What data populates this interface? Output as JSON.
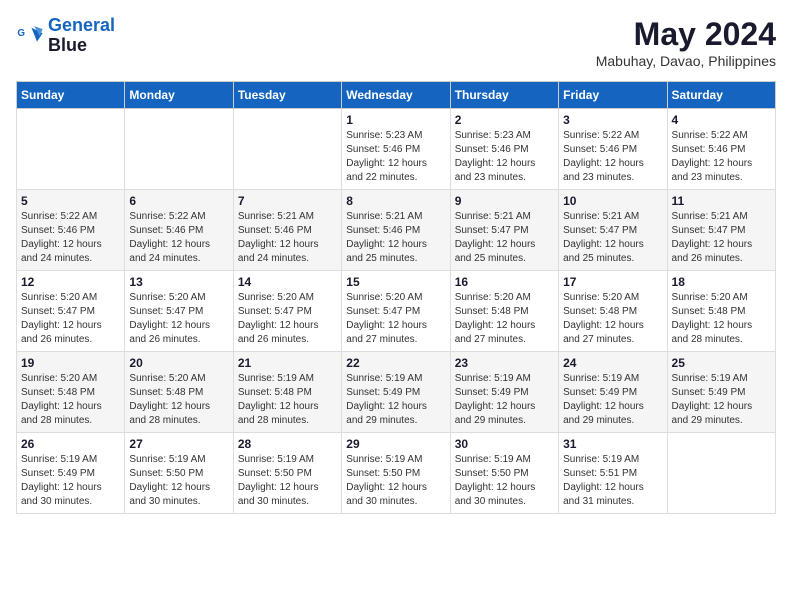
{
  "logo": {
    "line1": "General",
    "line2": "Blue"
  },
  "title": "May 2024",
  "subtitle": "Mabuhay, Davao, Philippines",
  "days_of_week": [
    "Sunday",
    "Monday",
    "Tuesday",
    "Wednesday",
    "Thursday",
    "Friday",
    "Saturday"
  ],
  "weeks": [
    [
      {
        "day": "",
        "info": ""
      },
      {
        "day": "",
        "info": ""
      },
      {
        "day": "",
        "info": ""
      },
      {
        "day": "1",
        "info": "Sunrise: 5:23 AM\nSunset: 5:46 PM\nDaylight: 12 hours\nand 22 minutes."
      },
      {
        "day": "2",
        "info": "Sunrise: 5:23 AM\nSunset: 5:46 PM\nDaylight: 12 hours\nand 23 minutes."
      },
      {
        "day": "3",
        "info": "Sunrise: 5:22 AM\nSunset: 5:46 PM\nDaylight: 12 hours\nand 23 minutes."
      },
      {
        "day": "4",
        "info": "Sunrise: 5:22 AM\nSunset: 5:46 PM\nDaylight: 12 hours\nand 23 minutes."
      }
    ],
    [
      {
        "day": "5",
        "info": "Sunrise: 5:22 AM\nSunset: 5:46 PM\nDaylight: 12 hours\nand 24 minutes."
      },
      {
        "day": "6",
        "info": "Sunrise: 5:22 AM\nSunset: 5:46 PM\nDaylight: 12 hours\nand 24 minutes."
      },
      {
        "day": "7",
        "info": "Sunrise: 5:21 AM\nSunset: 5:46 PM\nDaylight: 12 hours\nand 24 minutes."
      },
      {
        "day": "8",
        "info": "Sunrise: 5:21 AM\nSunset: 5:46 PM\nDaylight: 12 hours\nand 25 minutes."
      },
      {
        "day": "9",
        "info": "Sunrise: 5:21 AM\nSunset: 5:47 PM\nDaylight: 12 hours\nand 25 minutes."
      },
      {
        "day": "10",
        "info": "Sunrise: 5:21 AM\nSunset: 5:47 PM\nDaylight: 12 hours\nand 25 minutes."
      },
      {
        "day": "11",
        "info": "Sunrise: 5:21 AM\nSunset: 5:47 PM\nDaylight: 12 hours\nand 26 minutes."
      }
    ],
    [
      {
        "day": "12",
        "info": "Sunrise: 5:20 AM\nSunset: 5:47 PM\nDaylight: 12 hours\nand 26 minutes."
      },
      {
        "day": "13",
        "info": "Sunrise: 5:20 AM\nSunset: 5:47 PM\nDaylight: 12 hours\nand 26 minutes."
      },
      {
        "day": "14",
        "info": "Sunrise: 5:20 AM\nSunset: 5:47 PM\nDaylight: 12 hours\nand 26 minutes."
      },
      {
        "day": "15",
        "info": "Sunrise: 5:20 AM\nSunset: 5:47 PM\nDaylight: 12 hours\nand 27 minutes."
      },
      {
        "day": "16",
        "info": "Sunrise: 5:20 AM\nSunset: 5:48 PM\nDaylight: 12 hours\nand 27 minutes."
      },
      {
        "day": "17",
        "info": "Sunrise: 5:20 AM\nSunset: 5:48 PM\nDaylight: 12 hours\nand 27 minutes."
      },
      {
        "day": "18",
        "info": "Sunrise: 5:20 AM\nSunset: 5:48 PM\nDaylight: 12 hours\nand 28 minutes."
      }
    ],
    [
      {
        "day": "19",
        "info": "Sunrise: 5:20 AM\nSunset: 5:48 PM\nDaylight: 12 hours\nand 28 minutes."
      },
      {
        "day": "20",
        "info": "Sunrise: 5:20 AM\nSunset: 5:48 PM\nDaylight: 12 hours\nand 28 minutes."
      },
      {
        "day": "21",
        "info": "Sunrise: 5:19 AM\nSunset: 5:48 PM\nDaylight: 12 hours\nand 28 minutes."
      },
      {
        "day": "22",
        "info": "Sunrise: 5:19 AM\nSunset: 5:49 PM\nDaylight: 12 hours\nand 29 minutes."
      },
      {
        "day": "23",
        "info": "Sunrise: 5:19 AM\nSunset: 5:49 PM\nDaylight: 12 hours\nand 29 minutes."
      },
      {
        "day": "24",
        "info": "Sunrise: 5:19 AM\nSunset: 5:49 PM\nDaylight: 12 hours\nand 29 minutes."
      },
      {
        "day": "25",
        "info": "Sunrise: 5:19 AM\nSunset: 5:49 PM\nDaylight: 12 hours\nand 29 minutes."
      }
    ],
    [
      {
        "day": "26",
        "info": "Sunrise: 5:19 AM\nSunset: 5:49 PM\nDaylight: 12 hours\nand 30 minutes."
      },
      {
        "day": "27",
        "info": "Sunrise: 5:19 AM\nSunset: 5:50 PM\nDaylight: 12 hours\nand 30 minutes."
      },
      {
        "day": "28",
        "info": "Sunrise: 5:19 AM\nSunset: 5:50 PM\nDaylight: 12 hours\nand 30 minutes."
      },
      {
        "day": "29",
        "info": "Sunrise: 5:19 AM\nSunset: 5:50 PM\nDaylight: 12 hours\nand 30 minutes."
      },
      {
        "day": "30",
        "info": "Sunrise: 5:19 AM\nSunset: 5:50 PM\nDaylight: 12 hours\nand 30 minutes."
      },
      {
        "day": "31",
        "info": "Sunrise: 5:19 AM\nSunset: 5:51 PM\nDaylight: 12 hours\nand 31 minutes."
      },
      {
        "day": "",
        "info": ""
      }
    ]
  ]
}
